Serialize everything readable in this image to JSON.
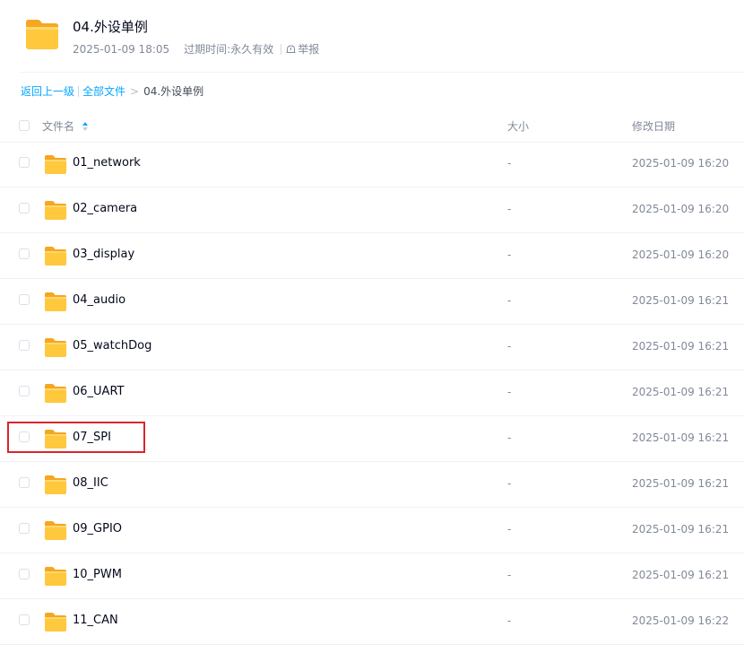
{
  "header": {
    "title": "04.外设单例",
    "share_time": "2025-01-09 18:05",
    "expire_label": "过期时间:",
    "expire_value": "永久有效",
    "report_label": "举报"
  },
  "breadcrumb": {
    "back": "返回上一级",
    "all_files": "全部文件",
    "separator": ">",
    "current": "04.外设单例"
  },
  "table": {
    "col_name": "文件名",
    "col_size": "大小",
    "col_date": "修改日期",
    "rows": [
      {
        "name": "01_network",
        "size": "-",
        "date": "2025-01-09 16:20"
      },
      {
        "name": "02_camera",
        "size": "-",
        "date": "2025-01-09 16:20"
      },
      {
        "name": "03_display",
        "size": "-",
        "date": "2025-01-09 16:20"
      },
      {
        "name": "04_audio",
        "size": "-",
        "date": "2025-01-09 16:21"
      },
      {
        "name": "05_watchDog",
        "size": "-",
        "date": "2025-01-09 16:21"
      },
      {
        "name": "06_UART",
        "size": "-",
        "date": "2025-01-09 16:21"
      },
      {
        "name": "07_SPI",
        "size": "-",
        "date": "2025-01-09 16:21"
      },
      {
        "name": "08_IIC",
        "size": "-",
        "date": "2025-01-09 16:21"
      },
      {
        "name": "09_GPIO",
        "size": "-",
        "date": "2025-01-09 16:21"
      },
      {
        "name": "10_PWM",
        "size": "-",
        "date": "2025-01-09 16:21"
      },
      {
        "name": "11_CAN",
        "size": "-",
        "date": "2025-01-09 16:22"
      }
    ]
  },
  "icons": {
    "folder": "folder-icon",
    "report": "report-icon",
    "sort": "sort-icon",
    "checkbox": "checkbox"
  },
  "colors": {
    "link": "#06a7ff",
    "folder_yellow": "#ffc83d",
    "highlight": "#d9262c",
    "muted_text": "#818999"
  }
}
